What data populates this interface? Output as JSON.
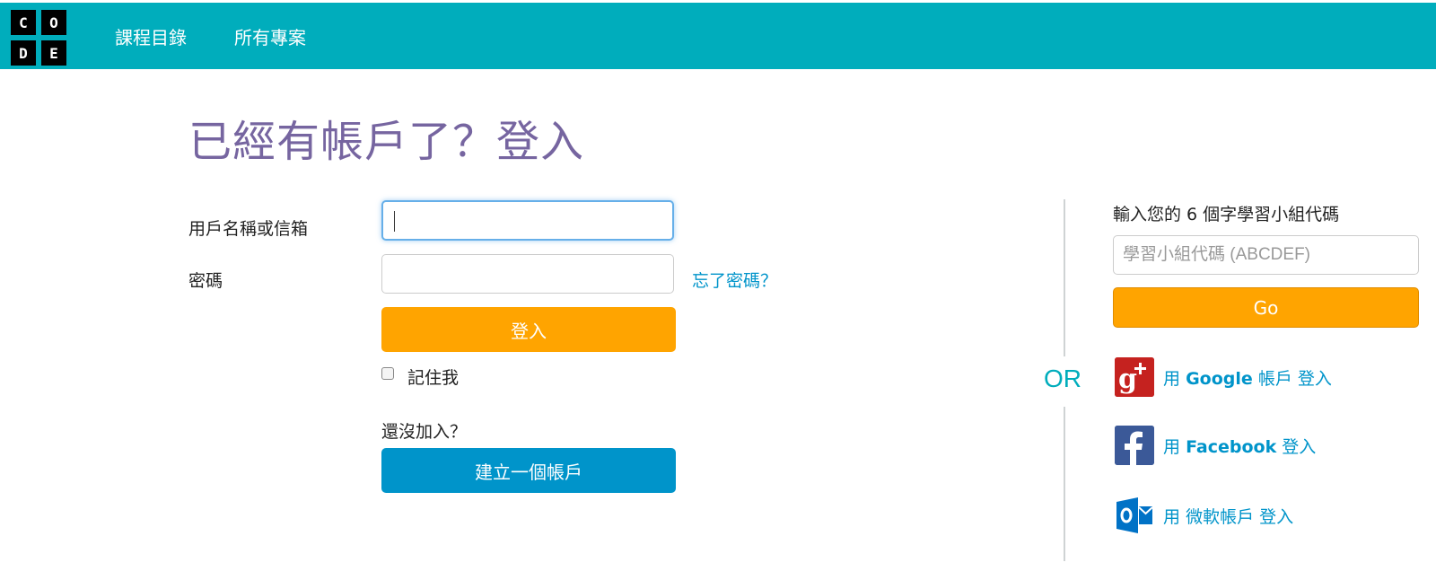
{
  "header": {
    "logo_letters": [
      "C",
      "O",
      "D",
      "E"
    ],
    "nav": [
      {
        "label": "課程目錄"
      },
      {
        "label": "所有專案"
      }
    ]
  },
  "page_title": "已經有帳戶了？登入",
  "login_form": {
    "username_label": "用戶名稱或信箱",
    "username_value": "",
    "password_label": "密碼",
    "password_value": "",
    "forgot_link": "忘了密碼？",
    "login_button": "登入",
    "remember_label": "記住我",
    "remember_checked": false,
    "not_joined_text": "還沒加入？",
    "create_account_button": "建立一個帳戶"
  },
  "divider_text": "OR",
  "section_code": {
    "label": "輸入您的 6 個字學習小組代碼",
    "placeholder": "學習小組代碼 (ABCDEF)",
    "go_button": "Go"
  },
  "social": [
    {
      "prefix": "用",
      "provider": "Google",
      "suffix": "帳戶 登入",
      "icon": "google-plus-icon"
    },
    {
      "prefix": "用",
      "provider": "Facebook",
      "suffix": "登入",
      "icon": "facebook-icon"
    },
    {
      "prefix": "用",
      "provider": "微軟帳戶",
      "suffix": "登入",
      "icon": "outlook-icon"
    }
  ],
  "colors": {
    "header_bg": "#00adbc",
    "title": "#7665a0",
    "orange": "#ffa400",
    "blue": "#0094ca",
    "or_text": "#00adbc"
  }
}
